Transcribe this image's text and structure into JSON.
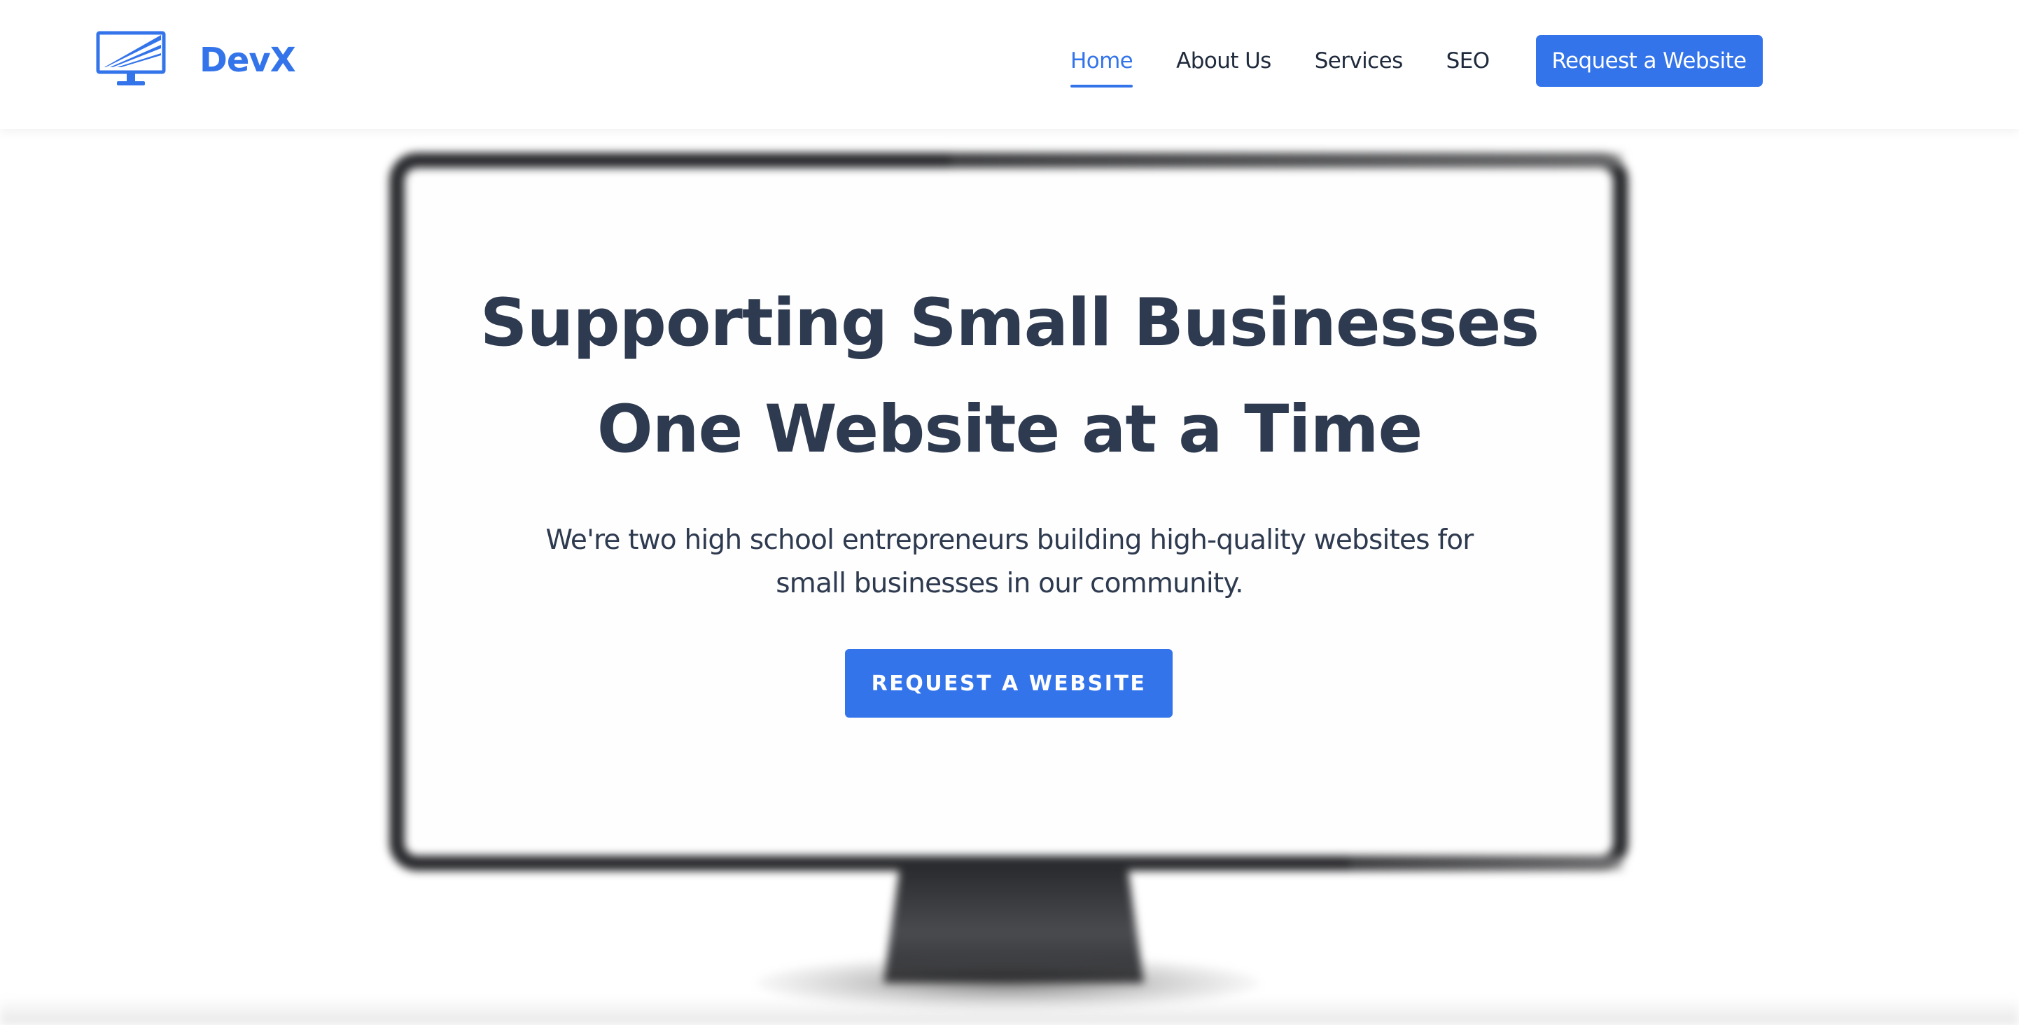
{
  "colors": {
    "brand": "#3474ea",
    "text_dark": "#2e3a4f",
    "nav_text": "#1f2a3c",
    "background": "#ffffff",
    "monitor_frame": "#2a2b2e"
  },
  "header": {
    "logo_icon": "monitor-logo-icon",
    "brand_name": "DevX",
    "nav": {
      "items": [
        {
          "label": "Home",
          "active": true
        },
        {
          "label": "About Us",
          "active": false
        },
        {
          "label": "Services",
          "active": false
        },
        {
          "label": "SEO",
          "active": false
        }
      ],
      "cta_label": "Request a Website"
    }
  },
  "hero": {
    "background": "blurred-desktop-monitor-photo",
    "title_line1": "Supporting Small Businesses",
    "title_line2": "One Website at a Time",
    "subtitle_line1": "We're two high school entrepreneurs building high-quality websites for",
    "subtitle_line2": "small businesses in our community.",
    "cta_label": "REQUEST A WEBSITE"
  }
}
